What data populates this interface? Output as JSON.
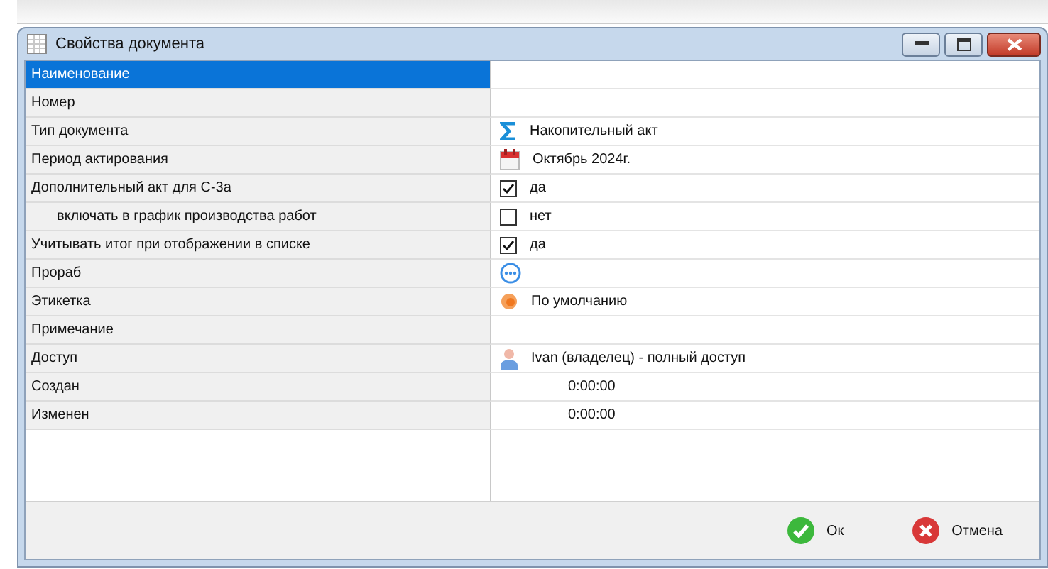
{
  "window": {
    "title": "Свойства документа"
  },
  "rows": [
    {
      "label": "Наименование",
      "selected": true,
      "indented": false,
      "kind": "text"
    },
    {
      "label": "Номер",
      "selected": false,
      "indented": false,
      "kind": "text"
    },
    {
      "label": "Тип документа",
      "selected": false,
      "indented": false,
      "kind": "sigma",
      "value": "Накопительный акт"
    },
    {
      "label": "Период актирования",
      "selected": false,
      "indented": false,
      "kind": "calendar",
      "value": "Октябрь 2024г."
    },
    {
      "label": "Дополнительный акт для С-3а",
      "selected": false,
      "indented": false,
      "kind": "checkbox",
      "checked": true,
      "value": "да"
    },
    {
      "label": "включать в график производства работ",
      "selected": false,
      "indented": true,
      "kind": "checkbox",
      "checked": false,
      "value": "нет"
    },
    {
      "label": "Учитывать итог при отображении в списке",
      "selected": false,
      "indented": false,
      "kind": "checkbox",
      "checked": true,
      "value": "да"
    },
    {
      "label": "Прораб",
      "selected": false,
      "indented": false,
      "kind": "picker"
    },
    {
      "label": "Этикетка",
      "selected": false,
      "indented": false,
      "kind": "tag",
      "value": "По умолчанию"
    },
    {
      "label": "Примечание",
      "selected": false,
      "indented": false,
      "kind": "text"
    },
    {
      "label": "Доступ",
      "selected": false,
      "indented": false,
      "kind": "user",
      "value": "Ivan (владелец) - полный доступ"
    },
    {
      "label": "Создан",
      "selected": false,
      "indented": false,
      "kind": "time",
      "value": "0:00:00"
    },
    {
      "label": "Изменен",
      "selected": false,
      "indented": false,
      "kind": "time",
      "value": "0:00:00"
    }
  ],
  "buttons": [
    {
      "kind": "ok",
      "label": "Ок"
    },
    {
      "kind": "cancel",
      "label": "Отмена"
    }
  ]
}
